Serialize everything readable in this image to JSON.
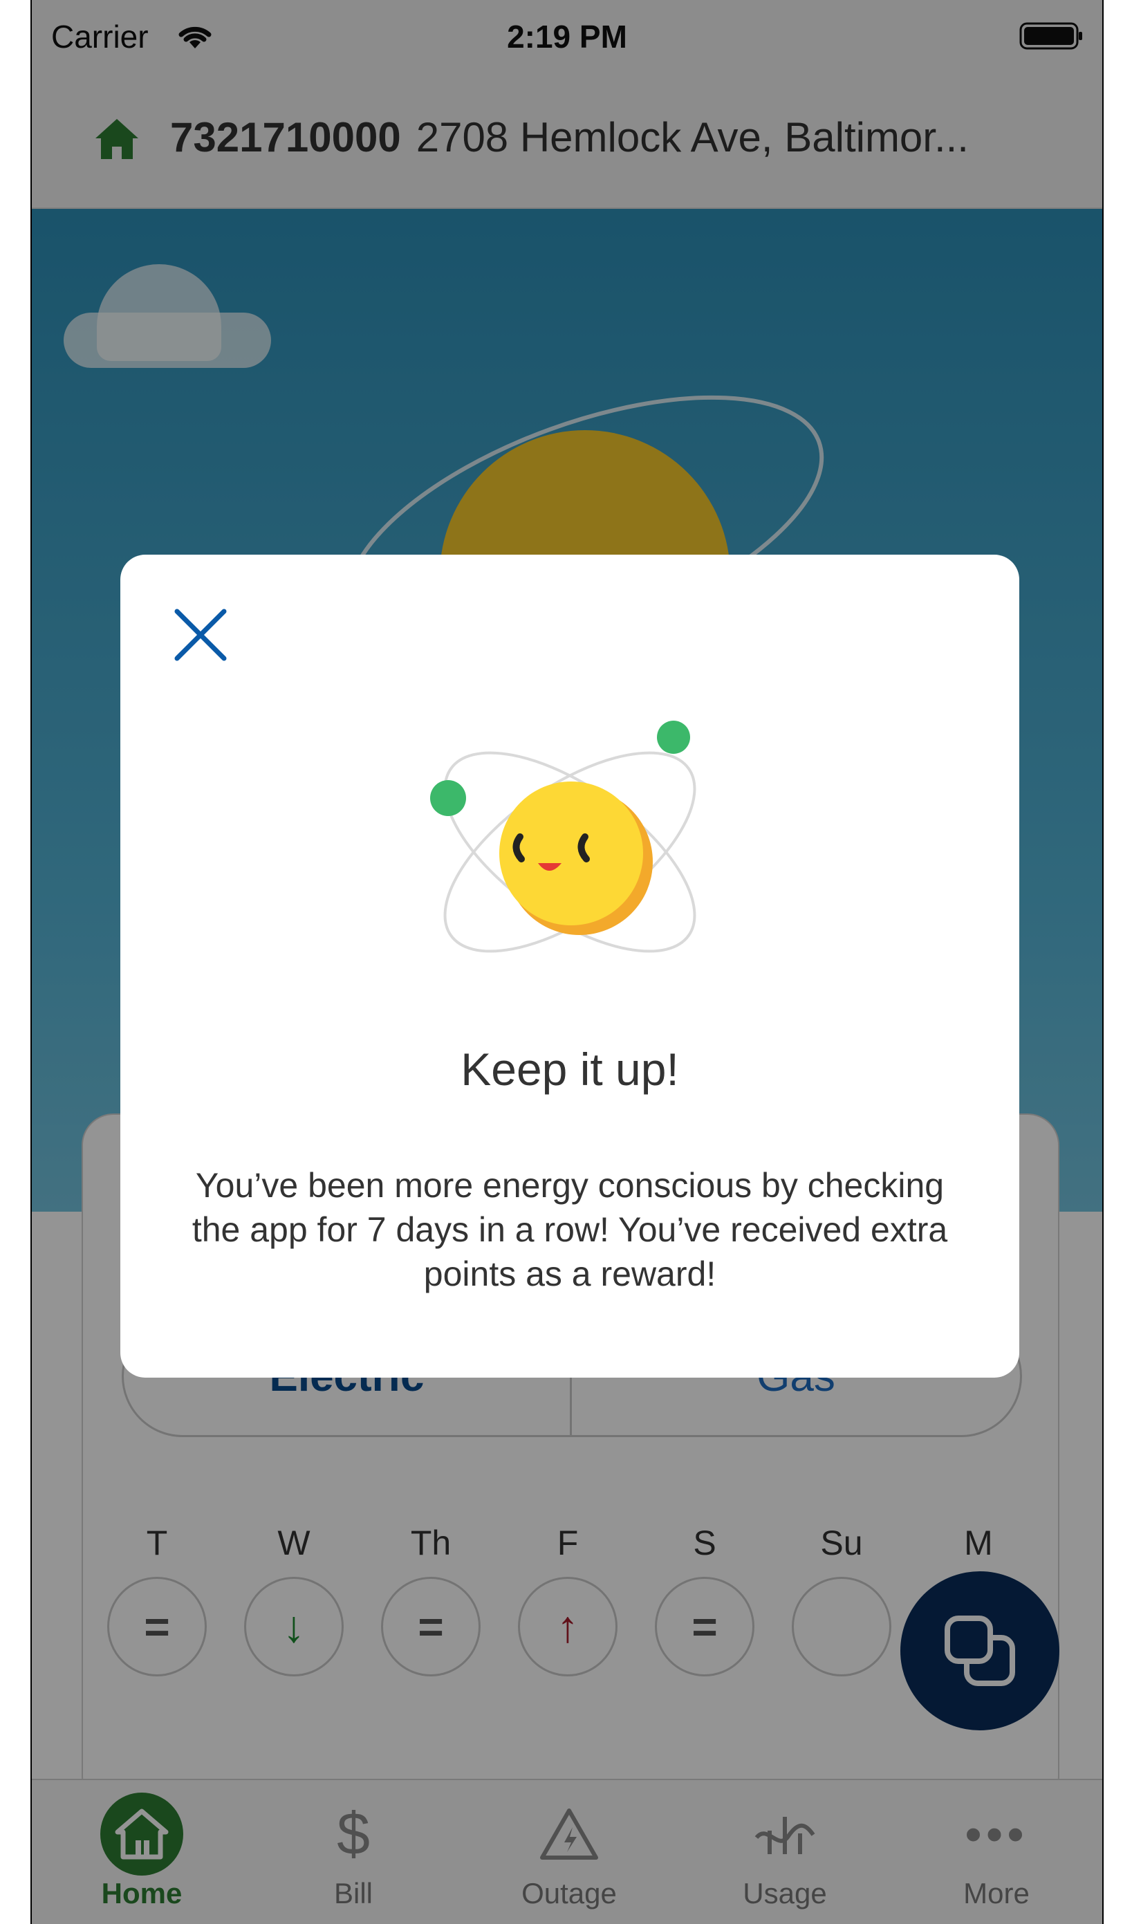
{
  "status_bar": {
    "carrier": "Carrier",
    "time": "2:19 PM"
  },
  "account": {
    "number": "7321710000",
    "address": "2708 Hemlock Ave, Baltimor..."
  },
  "usage_card": {
    "segments": [
      "Electric",
      "Gas"
    ],
    "days": [
      {
        "label": "T",
        "indicator": "="
      },
      {
        "label": "W",
        "indicator": "↓"
      },
      {
        "label": "Th",
        "indicator": "="
      },
      {
        "label": "F",
        "indicator": "↑"
      },
      {
        "label": "S",
        "indicator": "="
      },
      {
        "label": "Su",
        "indicator": ""
      },
      {
        "label": "M",
        "indicator": ""
      }
    ]
  },
  "modal": {
    "title": "Keep it up!",
    "body": "You’ve been more energy conscious by checking the app for 7 days in a row! You’ve received extra points as a reward!"
  },
  "tabs": [
    {
      "label": "Home",
      "icon": "home-icon",
      "active": true
    },
    {
      "label": "Bill",
      "icon": "dollar-icon",
      "active": false
    },
    {
      "label": "Outage",
      "icon": "outage-icon",
      "active": false
    },
    {
      "label": "Usage",
      "icon": "usage-icon",
      "active": false
    },
    {
      "label": "More",
      "icon": "more-icon",
      "active": false
    }
  ],
  "colors": {
    "brand_green": "#2e7d32",
    "navy": "#0a2c5a",
    "link_blue": "#0a4a8c",
    "sky": "#2d8fb7"
  }
}
